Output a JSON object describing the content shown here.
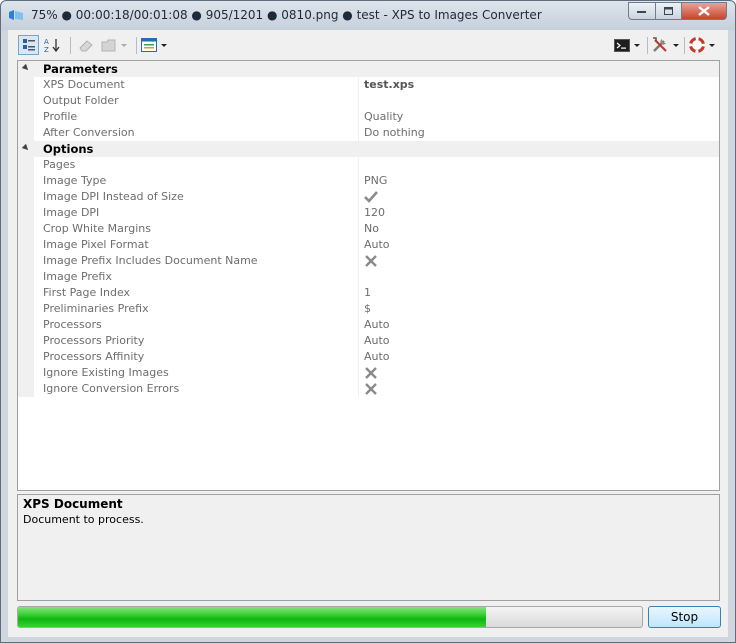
{
  "window": {
    "title": "75% ● 00:00:18/00:01:08 ● 905/1201 ● 0810.png ● test - XPS to Images Converter"
  },
  "toolbar": {
    "left_buttons": [
      "categorized-view-icon",
      "alphabetical-sort-icon",
      "eraser-icon",
      "folder-icon",
      "image-list-icon"
    ],
    "right_buttons": [
      "console-icon",
      "tools-icon",
      "help-lifebuoy-icon"
    ]
  },
  "grid": {
    "categories": [
      {
        "label": "Parameters",
        "properties": [
          {
            "name": "XPS Document",
            "value": "test.xps",
            "bold": true
          },
          {
            "name": "Output Folder",
            "value": ""
          },
          {
            "name": "Profile",
            "value": "Quality"
          },
          {
            "name": "After Conversion",
            "value": "Do nothing"
          }
        ]
      },
      {
        "label": "Options",
        "properties": [
          {
            "name": "Pages",
            "value": ""
          },
          {
            "name": "Image Type",
            "value": "PNG"
          },
          {
            "name": "Image DPI Instead of Size",
            "value": "",
            "icon": "check-icon"
          },
          {
            "name": "Image DPI",
            "value": "120"
          },
          {
            "name": "Crop White Margins",
            "value": "No"
          },
          {
            "name": "Image Pixel Format",
            "value": "Auto"
          },
          {
            "name": "Image Prefix Includes Document Name",
            "value": "",
            "icon": "cross-icon"
          },
          {
            "name": "Image Prefix",
            "value": ""
          },
          {
            "name": "First Page Index",
            "value": "1"
          },
          {
            "name": "Preliminaries Prefix",
            "value": "$"
          },
          {
            "name": "Processors",
            "value": "Auto"
          },
          {
            "name": "Processors Priority",
            "value": "Auto"
          },
          {
            "name": "Processors Affinity",
            "value": "Auto"
          },
          {
            "name": "Ignore Existing Images",
            "value": "",
            "icon": "cross-icon"
          },
          {
            "name": "Ignore Conversion Errors",
            "value": "",
            "icon": "cross-icon"
          }
        ]
      }
    ]
  },
  "help": {
    "title": "XPS Document",
    "description": "Document to process."
  },
  "progress": {
    "fraction": 0.75
  },
  "stop_label": "Stop",
  "colors": {
    "progress_green": "#12b914",
    "selection_border": "#3c7fb1"
  }
}
